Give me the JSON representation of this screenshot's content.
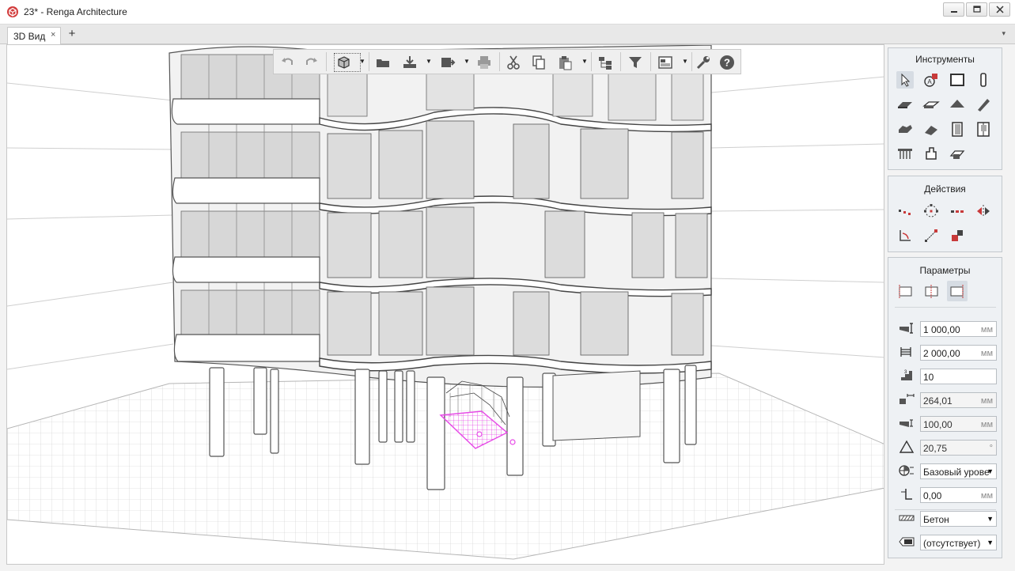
{
  "window": {
    "title": "23* - Renga Architecture"
  },
  "tabs": {
    "active_label": "3D Вид",
    "close": "×",
    "add": "+",
    "dropdown": "▾"
  },
  "toolbar": {
    "items": [
      "undo-icon",
      "redo-icon",
      "view-cube-icon",
      "open-icon",
      "import-icon",
      "export-icon",
      "print-icon",
      "cut-icon",
      "copy-icon",
      "paste-icon",
      "hierarchy-icon",
      "filter-icon",
      "layout-icon",
      "settings-wrench-icon",
      "help-icon"
    ]
  },
  "tools_panel": {
    "title": "Инструменты",
    "items": [
      "select-tool-icon",
      "annotation-tool-icon",
      "wall-tool-icon",
      "column-tool-icon",
      "slab-tool-icon",
      "floor-tool-icon",
      "roof-tool-icon",
      "beam-tool-icon",
      "stair-tool-icon",
      "ramp-tool-icon",
      "door-tool-icon",
      "window-tool-icon",
      "railing-tool-icon",
      "equipment-tool-icon",
      "opening-tool-icon"
    ]
  },
  "actions_panel": {
    "title": "Действия",
    "items": [
      "move-action-icon",
      "rotate-action-icon",
      "copy-action-icon",
      "mirror-action-icon",
      "align-action-icon",
      "stretch-action-icon",
      "replace-action-icon"
    ]
  },
  "params_panel": {
    "title": "Параметры",
    "alignment_items": [
      "align-left-icon",
      "align-center-icon",
      "align-right-icon"
    ],
    "rows": [
      {
        "icon": "stair-width-icon",
        "value": "1 000,00",
        "unit": "мм",
        "kind": "input"
      },
      {
        "icon": "stair-height-icon",
        "value": "2 000,00",
        "unit": "мм",
        "kind": "input"
      },
      {
        "icon": "step-count-icon",
        "value": "10",
        "unit": "",
        "kind": "input"
      },
      {
        "icon": "tread-depth-icon",
        "value": "264,01",
        "unit": "мм",
        "kind": "readonly"
      },
      {
        "icon": "riser-height-icon",
        "value": "100,00",
        "unit": "мм",
        "kind": "readonly"
      },
      {
        "icon": "slope-angle-icon",
        "value": "20,75",
        "unit": "°",
        "kind": "readonly"
      },
      {
        "icon": "base-level-icon",
        "value": "Базовый урове",
        "unit": "",
        "kind": "select"
      },
      {
        "icon": "offset-icon",
        "value": "0,00",
        "unit": "мм",
        "kind": "input"
      },
      {
        "icon": "material-icon",
        "value": "Бетон",
        "unit": "",
        "kind": "select"
      },
      {
        "icon": "mark-icon",
        "value": "(отсутствует)",
        "unit": "",
        "kind": "select"
      }
    ]
  },
  "colors": {
    "selection": "#e64ae6",
    "accent": "#c83a3a",
    "panel_bg": "#eef1f4"
  }
}
